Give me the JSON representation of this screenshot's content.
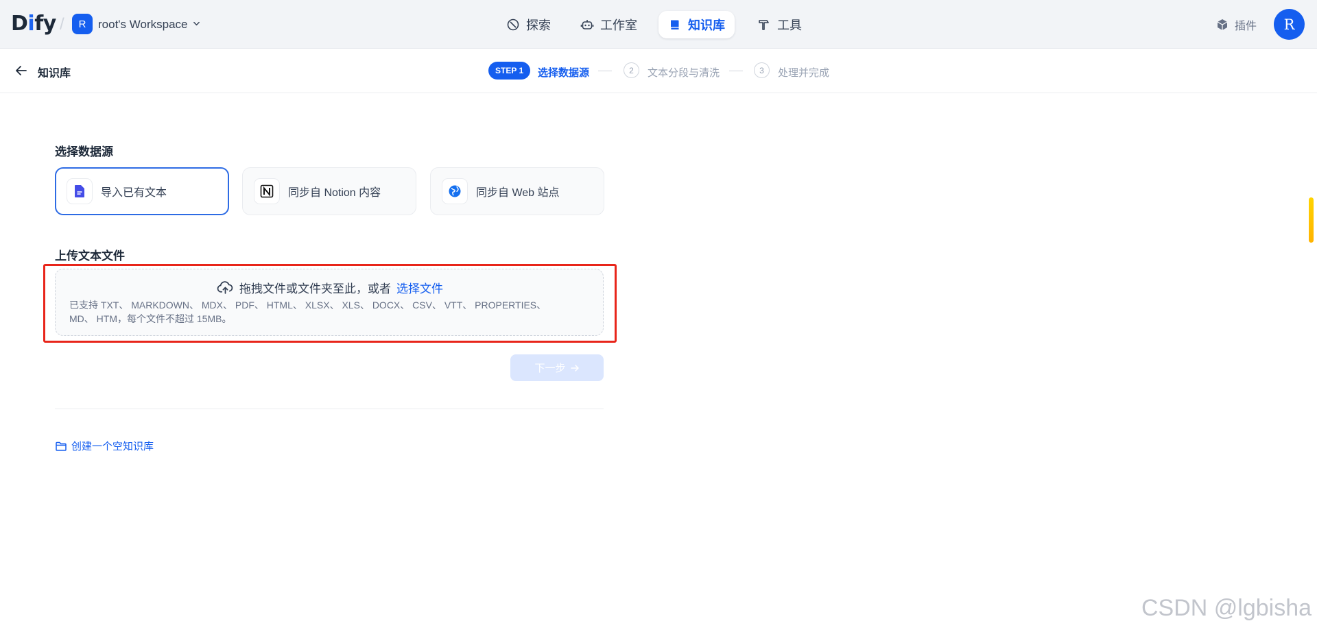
{
  "app": {
    "logo_left": "D",
    "logo_accent": "i",
    "logo_right": "fy",
    "workspace_initial": "R",
    "workspace_name": "root's Workspace"
  },
  "nav": {
    "explore": "探索",
    "studio": "工作室",
    "knowledge": "知识库",
    "tools": "工具",
    "plugins": "插件",
    "avatar_initial": "R",
    "active": "knowledge"
  },
  "subheader": {
    "back_label": "知识库",
    "steps": [
      {
        "badge": "STEP 1",
        "label": "选择数据源",
        "state": "active"
      },
      {
        "badge": "2",
        "label": "文本分段与清洗",
        "state": "pending"
      },
      {
        "badge": "3",
        "label": "处理并完成",
        "state": "pending"
      }
    ]
  },
  "datasource": {
    "title": "选择数据源",
    "options": [
      {
        "label": "导入已有文本",
        "icon": "file-text-icon",
        "selected": true
      },
      {
        "label": "同步自 Notion 内容",
        "icon": "notion-icon",
        "selected": false
      },
      {
        "label": "同步自 Web 站点",
        "icon": "globe-icon",
        "selected": false
      }
    ]
  },
  "upload": {
    "title": "上传文本文件",
    "drop_text": "拖拽文件或文件夹至此，或者",
    "select_link": "选择文件",
    "hint_line1": "已支持 TXT、 MARKDOWN、 MDX、 PDF、 HTML、 XLSX、 XLS、 DOCX、 CSV、 VTT、 PROPERTIES、",
    "hint_line2": "MD、 HTM，每个文件不超过 15MB。"
  },
  "actions": {
    "next": "下一步",
    "create_empty": "创建一个空知识库"
  },
  "colors": {
    "primary": "#155eef",
    "highlight": "#e8251a"
  },
  "watermark": "CSDN @lgbisha"
}
